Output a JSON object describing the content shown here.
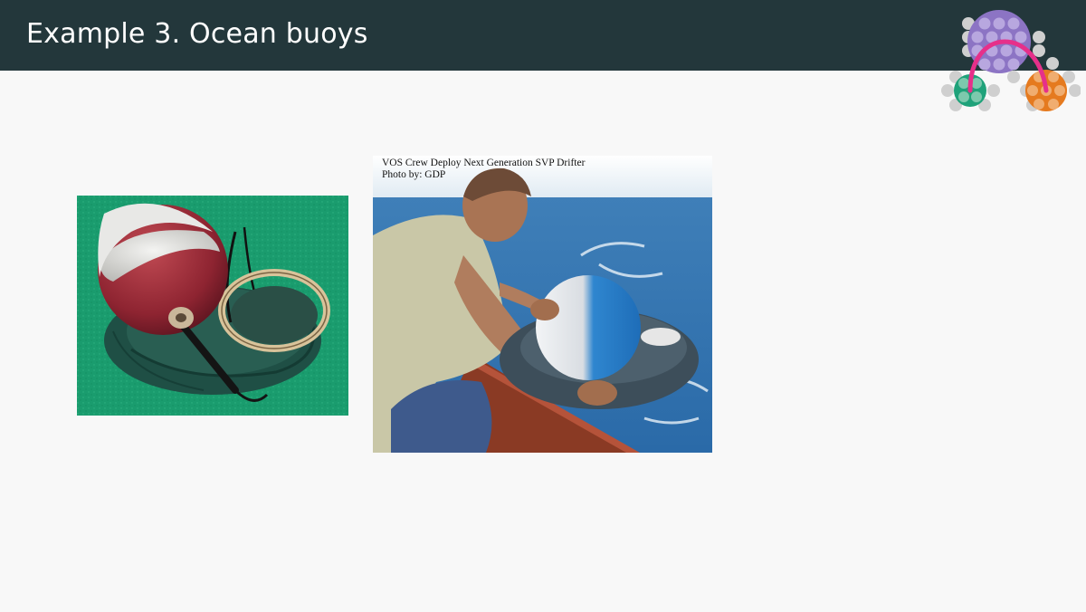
{
  "slide": {
    "title": "Example 3. Ocean buoys"
  },
  "logo": {
    "icon": "network-dots-logo",
    "colors": [
      "#8c74c4",
      "#1fa27a",
      "#e57a1f",
      "#e6308a"
    ]
  },
  "images": [
    {
      "name": "drifter-on-deck-photo"
    },
    {
      "name": "crew-deploying-drifter-photo",
      "caption_line1": "VOS Crew Deploy Next Generation SVP Drifter",
      "caption_line2": "Photo by: GDP"
    }
  ],
  "colors": {
    "header_bg": "#23373b",
    "page_bg": "#f8f8f8"
  }
}
